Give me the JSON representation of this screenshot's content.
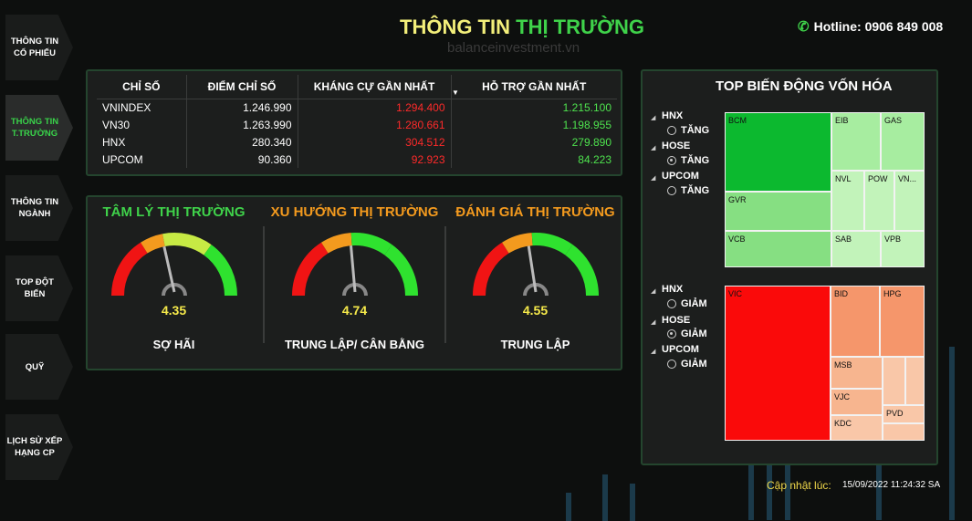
{
  "nav": [
    {
      "label_1": "THÔNG TIN",
      "label_2": "CỔ PHIẾU"
    },
    {
      "label_1": "THÔNG TIN",
      "label_2": "T.TRƯỜNG"
    },
    {
      "label_1": "THÔNG TIN",
      "label_2": "NGÀNH"
    },
    {
      "label_1": "TOP ĐỘT",
      "label_2": "BIẾN"
    },
    {
      "label_1": "QUỸ",
      "label_2": ""
    },
    {
      "label_1": "LỊCH SỬ XẾP",
      "label_2": "HẠNG CP"
    }
  ],
  "header": {
    "title_part1": "THÔNG TIN",
    "title_part2": "THỊ TRƯỜNG",
    "watermark": "balanceinvestment.vn",
    "hotline": "Hotline: 0906 849 008"
  },
  "index_table": {
    "columns": [
      "CHỈ SỐ",
      "ĐIỂM CHỈ SỐ",
      "KHÁNG CỰ GẦN NHẤT",
      "HỖ TRỢ GẦN NHẤT"
    ],
    "rows": [
      {
        "name": "VNINDEX",
        "point": "1.246.990",
        "resistance": "1.294.400",
        "support": "1.215.100"
      },
      {
        "name": "VN30",
        "point": "1.263.990",
        "resistance": "1.280.661",
        "support": "1.198.955"
      },
      {
        "name": "HNX",
        "point": "280.340",
        "resistance": "304.512",
        "support": "279.890"
      },
      {
        "name": "UPCOM",
        "point": "90.360",
        "resistance": "92.923",
        "support": "84.223"
      }
    ]
  },
  "gauges": [
    {
      "title": "TÂM LÝ THỊ TRƯỜNG",
      "title_color": "#3fd24a",
      "value": "4.35",
      "needle": 4.35,
      "label": "SỢ HÃI"
    },
    {
      "title": "XU HƯỚNG THỊ TRƯỜNG",
      "title_color": "#f39a1e",
      "value": "4.74",
      "needle": 4.74,
      "label": "TRUNG LẬP/ CÂN BẰNG"
    },
    {
      "title": "ĐÁNH GIÁ THỊ TRƯỜNG",
      "title_color": "#f39a1e",
      "value": "4.55",
      "needle": 4.55,
      "label": "TRUNG LẬP"
    }
  ],
  "top_cap": {
    "title": "TOP BIẾN ĐỘNG VỐN HÓA",
    "up_filters": [
      {
        "exchange": "HNX",
        "option": "TĂNG",
        "selected": false
      },
      {
        "exchange": "HOSE",
        "option": "TĂNG",
        "selected": true
      },
      {
        "exchange": "UPCOM",
        "option": "TĂNG",
        "selected": false
      }
    ],
    "down_filters": [
      {
        "exchange": "HNX",
        "option": "GIẢM",
        "selected": false
      },
      {
        "exchange": "HOSE",
        "option": "GIẢM",
        "selected": true
      },
      {
        "exchange": "UPCOM",
        "option": "GIẢM",
        "selected": false
      }
    ],
    "up_tiles": [
      "BCM",
      "EIB",
      "GAS",
      "NVL",
      "POW",
      "VN...",
      "GVR",
      "VCB",
      "SAB",
      "VPB"
    ],
    "down_tiles": [
      "VIC",
      "BID",
      "HPG",
      "MSB",
      "VJC",
      "KDC",
      "PVD"
    ]
  },
  "update": {
    "label": "Cập nhật lúc:",
    "value": "15/09/2022 11:24:32 SA"
  }
}
